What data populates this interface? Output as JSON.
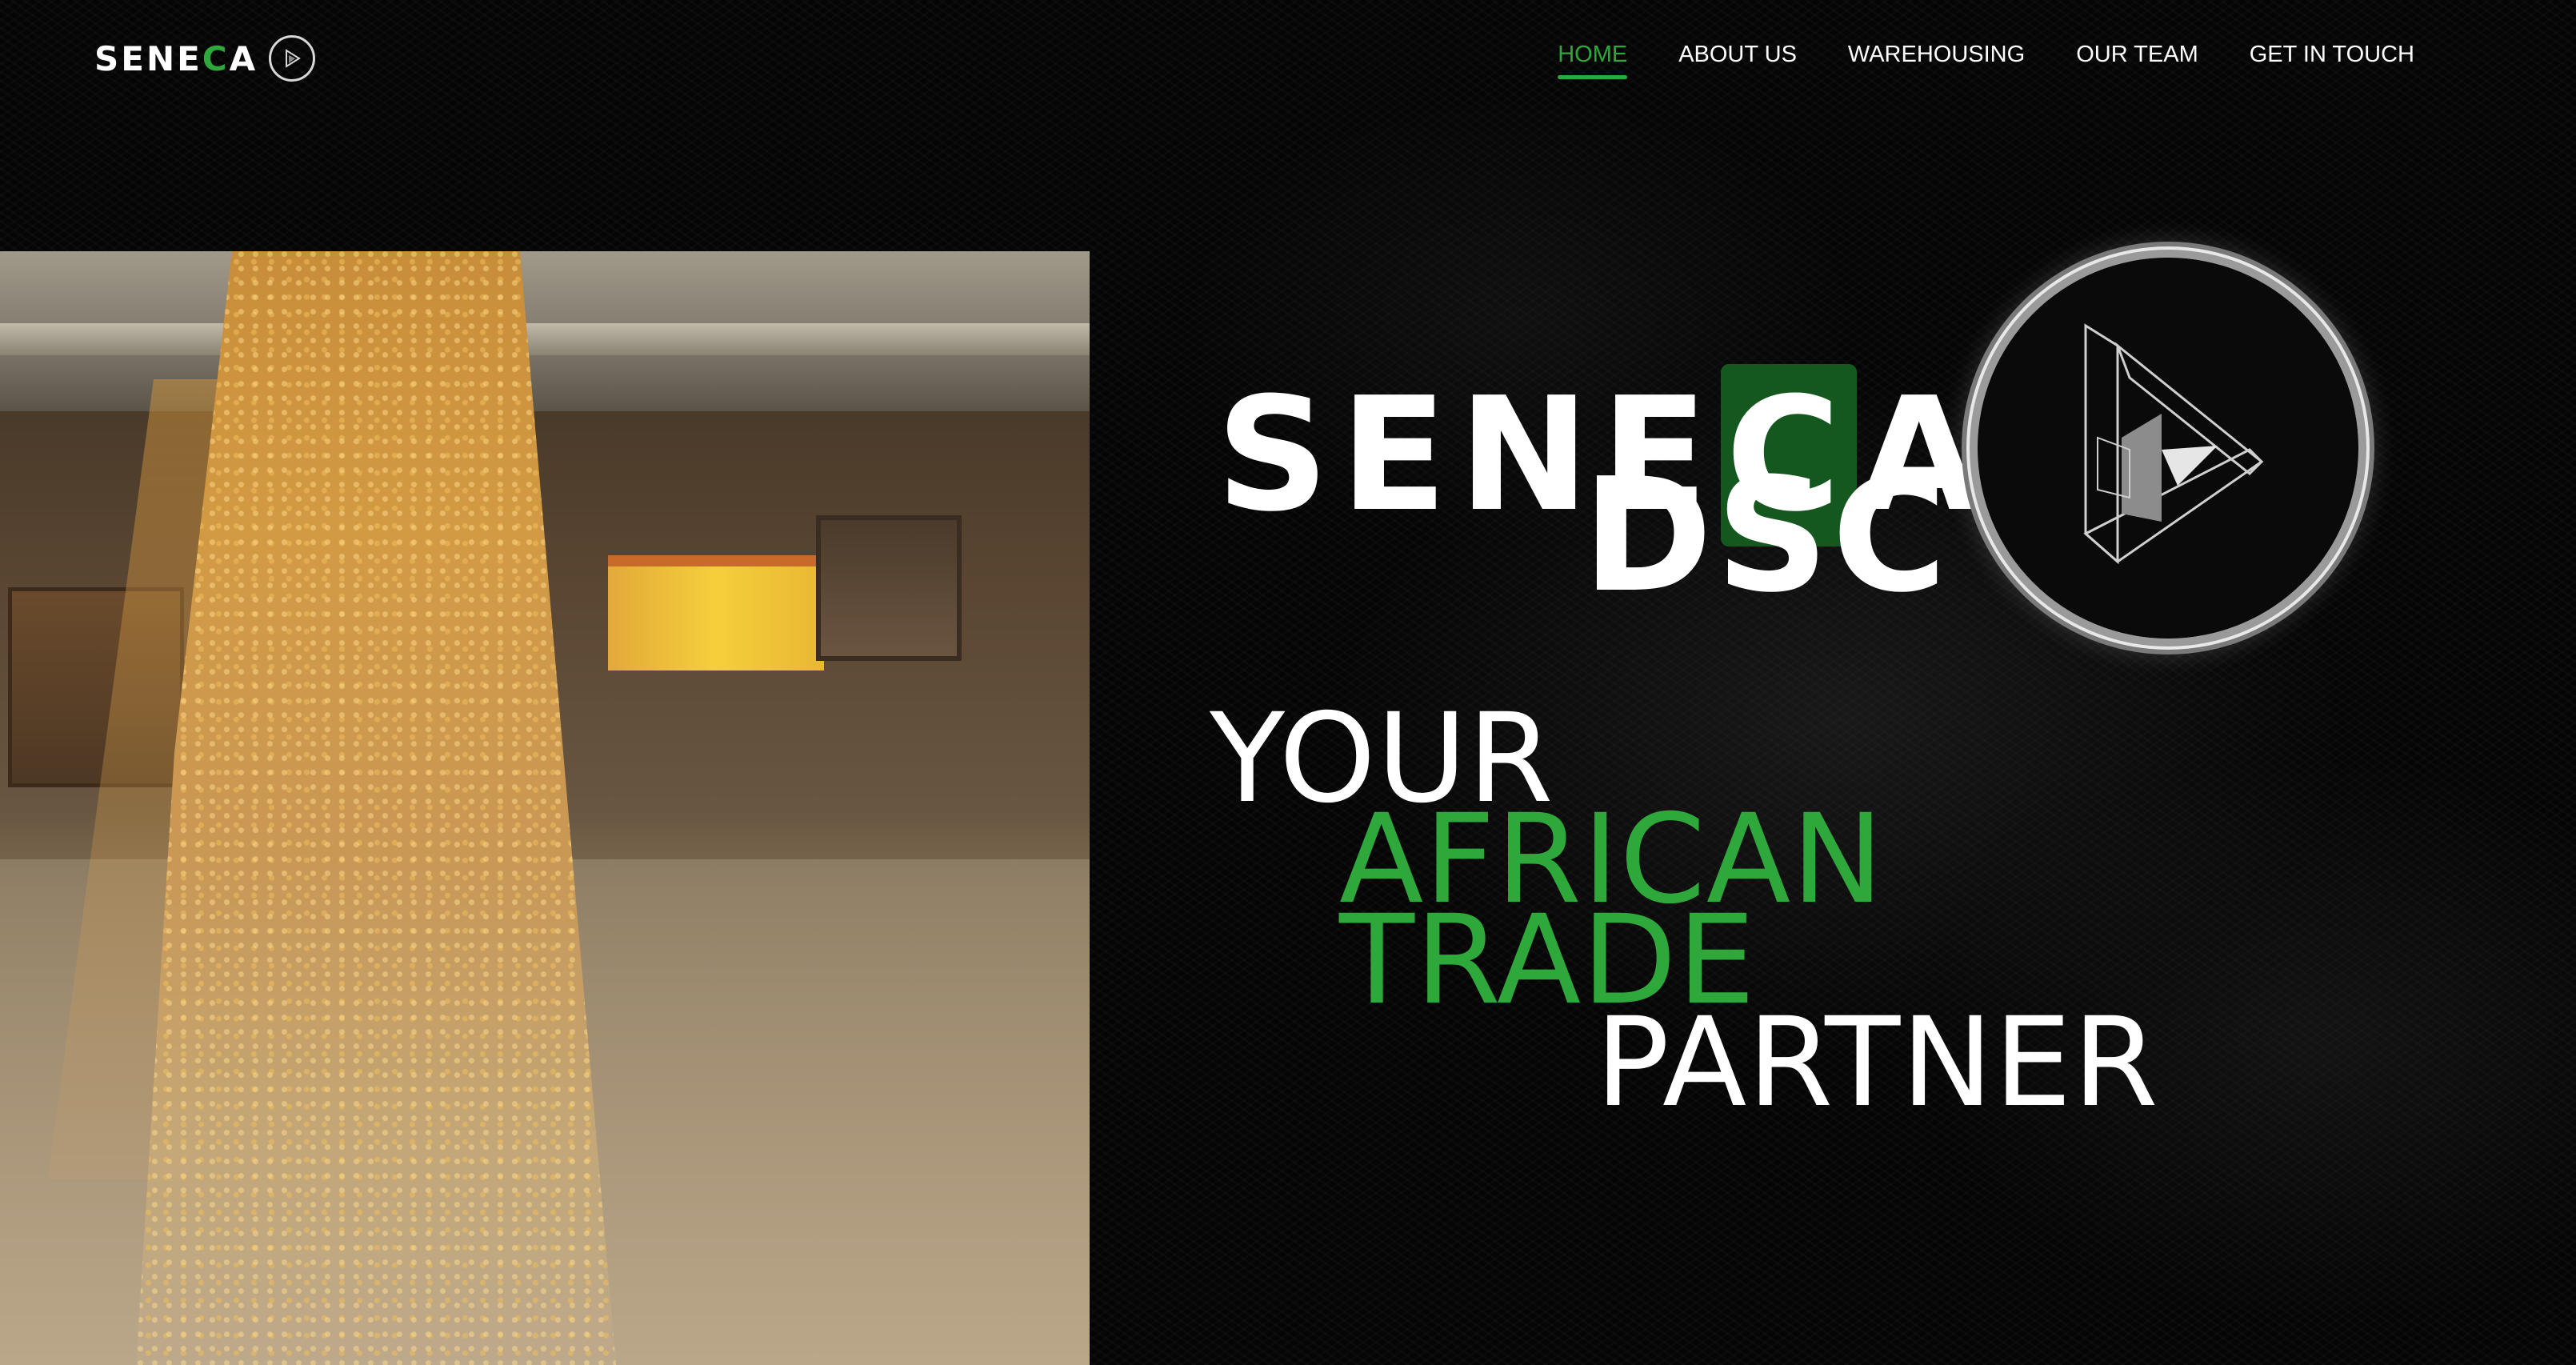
{
  "header": {
    "logo": {
      "text_pre": "SENE",
      "text_hl": "C",
      "text_post": "A"
    },
    "nav": [
      {
        "label": "HOME",
        "active": true
      },
      {
        "label": "ABOUT US",
        "active": false
      },
      {
        "label": "WAREHOUSING",
        "active": false
      },
      {
        "label": "OUR TEAM",
        "active": false
      },
      {
        "label": "GET IN TOUCH",
        "active": false
      }
    ]
  },
  "hero": {
    "brand": {
      "pre": "SENE",
      "boxed": "C",
      "post": "A",
      "sub": "DSC"
    },
    "tagline": [
      "YOUR",
      "AFRICAN",
      "TRADE",
      "PARTNER"
    ],
    "image": "grain-pouring-photo",
    "emblem": "impossible-triangle-emblem"
  },
  "colors": {
    "accent": "#2ea83a",
    "boxed_letter_bg": "#14581f",
    "background": "#050505"
  }
}
